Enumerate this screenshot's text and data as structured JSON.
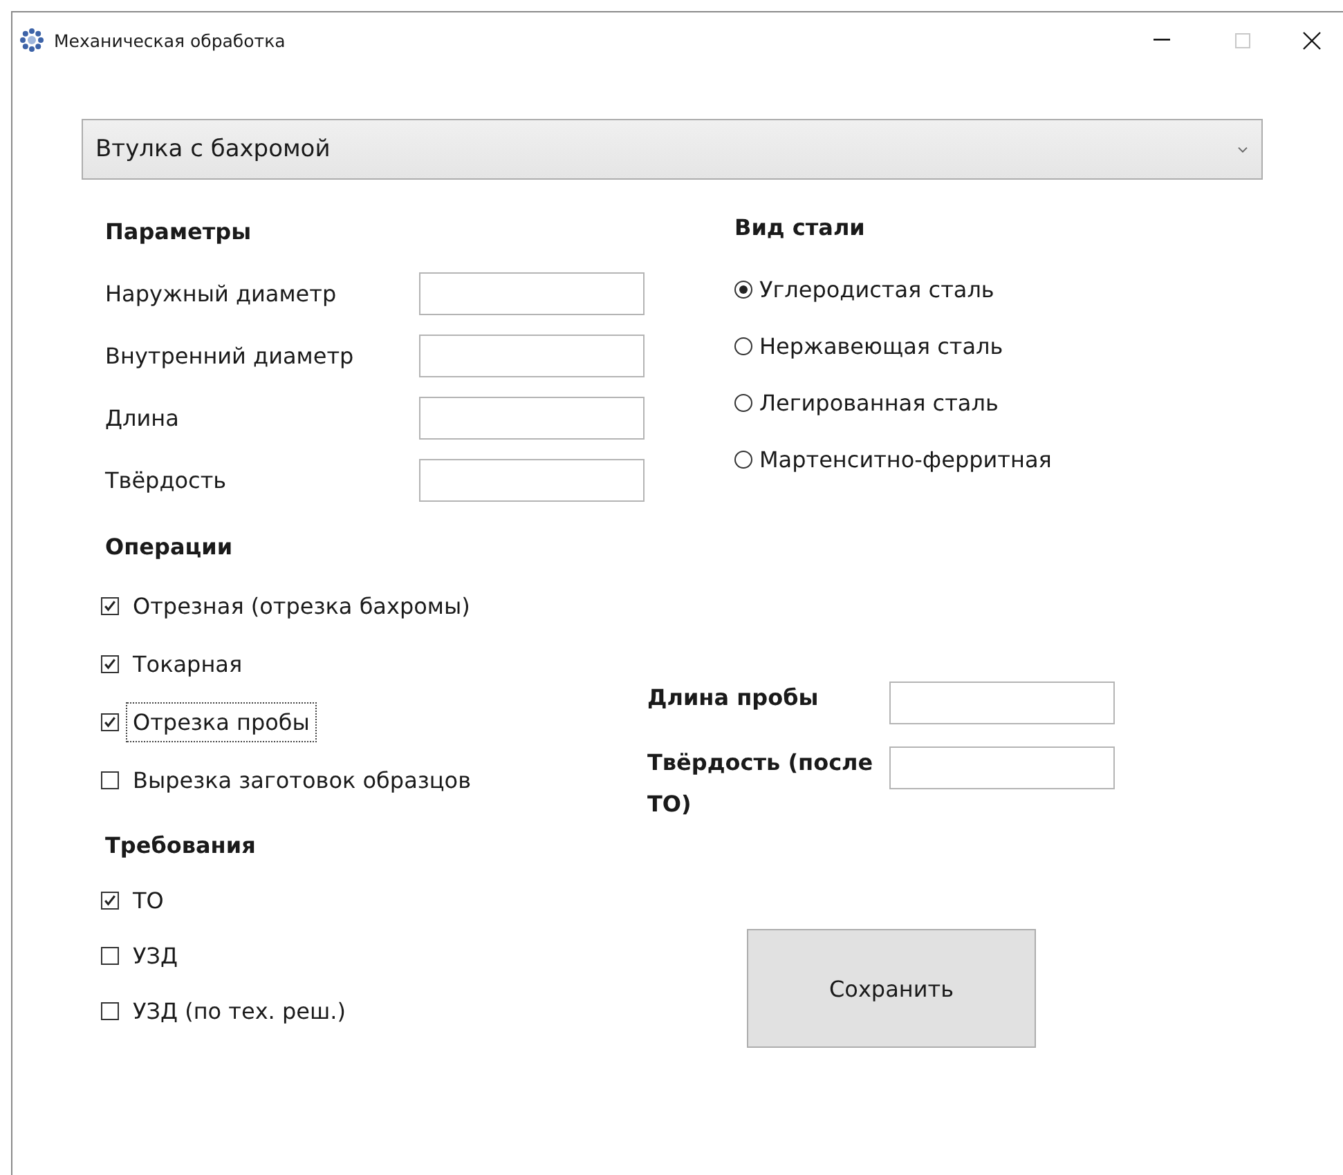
{
  "window": {
    "title": "Механическая обработка",
    "maximize_enabled": false
  },
  "part_type": {
    "value": "Втулка с бахромой"
  },
  "parameters": {
    "heading": "Параметры",
    "fields": [
      {
        "label": "Наружный диаметр"
      },
      {
        "label": "Внутренний диаметр"
      },
      {
        "label": "Длина"
      },
      {
        "label": "Твёрдость"
      }
    ]
  },
  "operations": {
    "heading": "Операции",
    "items": [
      {
        "label": "Отрезная (отрезка бахромы)",
        "checked": true,
        "focused": false
      },
      {
        "label": "Токарная",
        "checked": true,
        "focused": false
      },
      {
        "label": "Отрезка пробы",
        "checked": true,
        "focused": true
      },
      {
        "label": "Вырезка заготовок образцов",
        "checked": false,
        "focused": false
      }
    ]
  },
  "requirements": {
    "heading": "Требования",
    "items": [
      {
        "label": "ТО",
        "checked": true,
        "focused": false
      },
      {
        "label": "УЗД",
        "checked": false,
        "focused": false
      },
      {
        "label": "УЗД (по тех. реш.)",
        "checked": false,
        "focused": false
      }
    ]
  },
  "steel_type": {
    "heading": "Вид стали",
    "options": [
      {
        "label": "Углеродистая сталь",
        "selected": true
      },
      {
        "label": "Нержавеющая сталь",
        "selected": false
      },
      {
        "label": "Легированная сталь",
        "selected": false
      },
      {
        "label": "Мартенситно-ферритная",
        "selected": false
      }
    ]
  },
  "sample": {
    "fields": [
      {
        "label": "Длина пробы"
      },
      {
        "label": "Твёрдость (после ТО)"
      }
    ]
  },
  "save_button": {
    "label": "Сохранить"
  }
}
